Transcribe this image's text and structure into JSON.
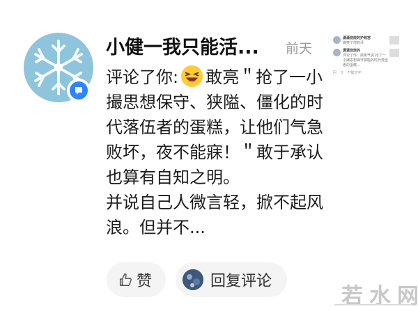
{
  "notification": {
    "username": "小健一我只能活...",
    "time": "前天",
    "comment_lines": [
      {
        "prefix": "评论了你:",
        "text": "敢亮＂抢了一小撮思想保守、狭隘、僵化的时代落伍者的蛋糕，让他们气急败坏，夜不能寐！＂敢于承认也算有自知之明。"
      },
      {
        "text": "并说自己人微言轻，掀不起风浪。但并不..."
      }
    ],
    "emoji": "laughing-face"
  },
  "actions": {
    "like_label": "赞",
    "reply_label": "回复评论"
  },
  "thumbnail": {
    "name1": "潇潇烧烧的护甸宫",
    "text1": "微笑了你的评",
    "name2": "潇潇烧烧的",
    "text2": "评论了你：搞笑气说 抢了一小撮思想保守狭隘的时代落伍者的蛋糕...",
    "footer_reply": "回",
    "footer_like": "0",
    "footer_more": "下载文字"
  },
  "watermark": {
    "text": "若水网"
  },
  "colors": {
    "avatar_bg": "#8ec4dc",
    "badge": "#2b86ff",
    "text": "#1c1c1c",
    "muted": "#9a9a9a",
    "pill_bg": "#f4f4f4"
  }
}
